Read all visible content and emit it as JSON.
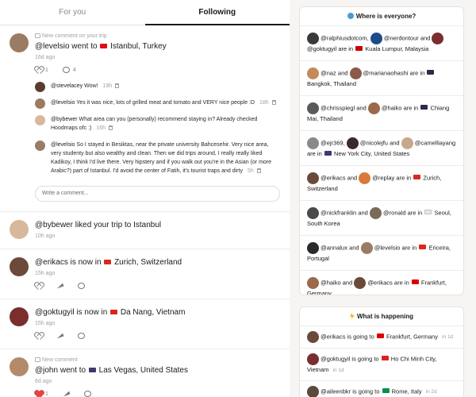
{
  "tabs": [
    {
      "label": "For you",
      "active": false
    },
    {
      "label": "Following",
      "active": true
    }
  ],
  "post1": {
    "kicker": "New comment on your trip",
    "user": "@levelsio",
    "verb": "went to",
    "place": "Istanbul, Turkey",
    "flag_colors": [
      "#e30a17"
    ],
    "time": "16d ago",
    "likes": "1",
    "comments": "4",
    "comments_list": [
      {
        "user": "@stevelacey",
        "text": "Wow!",
        "time": "19h"
      },
      {
        "user": "@levelsio",
        "text": "Yes it was nice, lots of grilled meat and tomato and VERY nice people :D",
        "time": "18h"
      },
      {
        "user": "@bybewer",
        "text": "What area can you (personally) recommend staying in? Already checked Hoodmaps ofc :)",
        "time": "16h"
      },
      {
        "user": "@levelsio",
        "text": "So I stayed in Besiktas, near the private university Bahcesehir. Very nice area, very studenty but also wealthy and clean. Then we did trips around, I really really liked Kadikoy, I think I'd live there. Very hipstery and if you walk out you're in the Asian (or more Arabic?) part of Istanbul. I'd avoid the center of Fatih, it's tourist traps and dirty",
        "time": "5h"
      }
    ],
    "write_placeholder": "Write a comment..."
  },
  "post2": {
    "user": "@bybewer",
    "text": "liked your trip to Istanbul",
    "time": "10h ago"
  },
  "post3": {
    "user": "@erikacs",
    "verb": "is now in",
    "place": "Zurich, Switzerland",
    "time": "15h ago"
  },
  "post4": {
    "user": "@goktugyil",
    "verb": "is now in",
    "place": "Da Nang, Vietnam",
    "time": "15h ago"
  },
  "post5": {
    "kicker": "New comment",
    "user": "@john",
    "verb": "went to",
    "place": "Las Vegas, United States",
    "time": "6d ago",
    "likes": "1"
  },
  "where": {
    "title": "Where is everyone?",
    "rows": [
      {
        "users": [
          "@ralphiusdotcom",
          "@nerdontour",
          "@goktugyil"
        ],
        "place": "Kuala Lumpur, Malaysia"
      },
      {
        "users": [
          "@naz",
          "@marianaohashi"
        ],
        "place": "Bangkok, Thailand"
      },
      {
        "users": [
          "@chrisspiegl",
          "@haiko"
        ],
        "place": "Chiang Mai, Thailand"
      },
      {
        "users": [
          "@ejr369",
          "@nicolejfu",
          "@camelliayang"
        ],
        "place": "New York City, United States"
      },
      {
        "users": [
          "@erikacs",
          "@replay"
        ],
        "place": "Zurich, Switzerland"
      },
      {
        "users": [
          "@nickfranklin",
          "@ronald"
        ],
        "place": "Seoul, South Korea"
      },
      {
        "users": [
          "@annalux",
          "@levelsio"
        ],
        "place": "Ericeira, Portugal"
      },
      {
        "users": [
          "@haiko",
          "@erikacs"
        ],
        "place": "Frankfurt, Germany"
      }
    ]
  },
  "happening": {
    "title": "What is happening",
    "rows": [
      {
        "user": "@erikacs",
        "text": "is going to",
        "place": "Frankfurt, Germany",
        "time": "in 1d"
      },
      {
        "user": "@goktugyil",
        "text": "is going to",
        "place": "Ho Chi Minh City, Vietnam",
        "time": "in 1d"
      },
      {
        "user": "@aileenbkr",
        "text": "is going to",
        "place": "Rome, Italy",
        "time": "in 2d"
      }
    ]
  },
  "words": {
    "and": "and",
    "are_in": "are in",
    "comma": ","
  }
}
